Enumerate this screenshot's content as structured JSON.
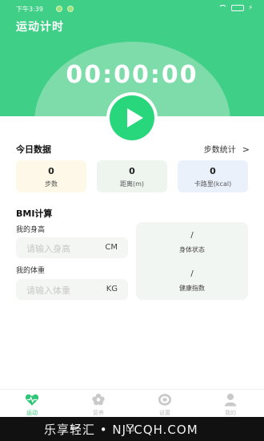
{
  "status_bar": {
    "time": "下午3:39"
  },
  "header": {
    "title": "运动计时",
    "timer": "00:00:00"
  },
  "today": {
    "title": "今日数据",
    "link_label": "步数统计",
    "link_chevron": ">",
    "stats": [
      {
        "value": "0",
        "label": "步数"
      },
      {
        "value": "0",
        "label": "距离(m)"
      },
      {
        "value": "0",
        "label": "卡路里(kcal)"
      }
    ]
  },
  "bmi": {
    "title": "BMI计算",
    "height_label": "我的身高",
    "height_placeholder": "请输入身高",
    "height_unit": "CM",
    "weight_label": "我的体重",
    "weight_placeholder": "请输入体重",
    "weight_unit": "KG",
    "body_state_value": "/",
    "body_state_label": "身体状态",
    "health_value": "/",
    "health_label": "健康指数"
  },
  "nav": [
    {
      "label": "运动",
      "icon": "heart-pulse-icon",
      "active": true
    },
    {
      "label": "营养",
      "icon": "flower-icon",
      "active": false
    },
    {
      "label": "设置",
      "icon": "tracker-icon",
      "active": false
    },
    {
      "label": "我的",
      "icon": "person-icon",
      "active": false
    }
  ],
  "watermark": {
    "text": "乐享轻汇 • NJYCQH.COM"
  },
  "colors": {
    "primary": "#3fcf86",
    "accent": "#28d67b",
    "dome": "#7ddcaa"
  }
}
